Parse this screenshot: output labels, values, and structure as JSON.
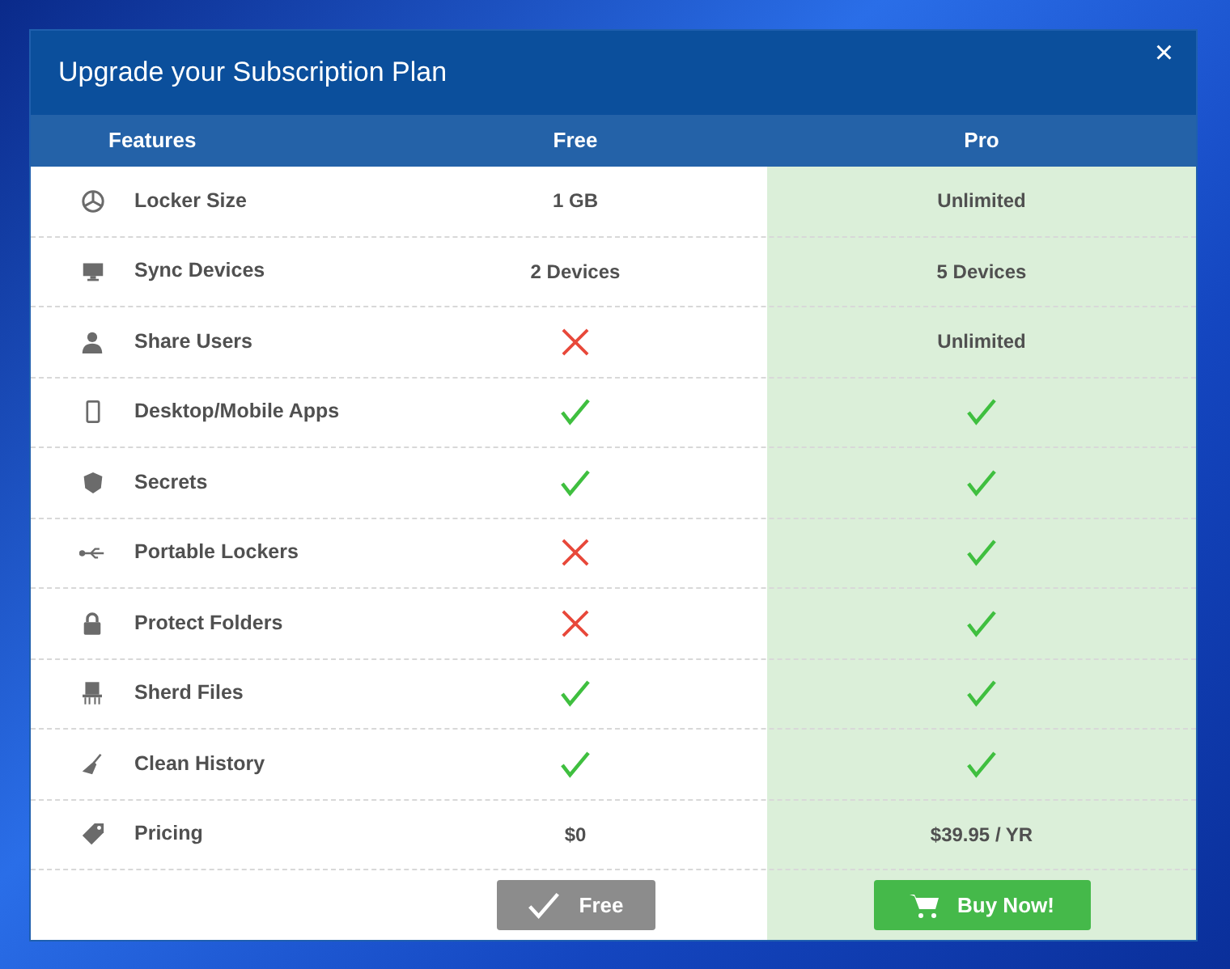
{
  "window": {
    "title": "Upgrade your Subscription Plan",
    "close": "×"
  },
  "columns": [
    "Features",
    "Free",
    "Pro"
  ],
  "rows": [
    {
      "feature": "Locker Size",
      "free": {
        "kind": "text",
        "text": "1 GB"
      },
      "pro": {
        "kind": "text",
        "text": "Unlimited"
      }
    },
    {
      "feature": "Sync Devices",
      "free": {
        "kind": "text",
        "text": "2 Devices"
      },
      "pro": {
        "kind": "text",
        "text": "5 Devices"
      }
    },
    {
      "feature": "Share Users",
      "free": {
        "kind": "no"
      },
      "pro": {
        "kind": "text",
        "text": "Unlimited"
      }
    },
    {
      "feature": "Desktop/Mobile Apps",
      "free": {
        "kind": "yes"
      },
      "pro": {
        "kind": "yes"
      }
    },
    {
      "feature": "Secrets",
      "free": {
        "kind": "yes"
      },
      "pro": {
        "kind": "yes"
      }
    },
    {
      "feature": "Portable Lockers",
      "free": {
        "kind": "no"
      },
      "pro": {
        "kind": "yes"
      }
    },
    {
      "feature": "Protect Folders",
      "free": {
        "kind": "no"
      },
      "pro": {
        "kind": "yes"
      }
    },
    {
      "feature": "Sherd Files",
      "free": {
        "kind": "yes"
      },
      "pro": {
        "kind": "yes"
      }
    },
    {
      "feature": "Clean History",
      "free": {
        "kind": "yes"
      },
      "pro": {
        "kind": "yes"
      }
    },
    {
      "feature": "Pricing",
      "free": {
        "kind": "text",
        "text": "$0"
      },
      "pro": {
        "kind": "text",
        "text": "$39.95 / YR"
      }
    }
  ],
  "buttons": [
    {
      "label": "Free",
      "disabled": true
    },
    {
      "label": "Buy Now!",
      "disabled": false
    }
  ]
}
